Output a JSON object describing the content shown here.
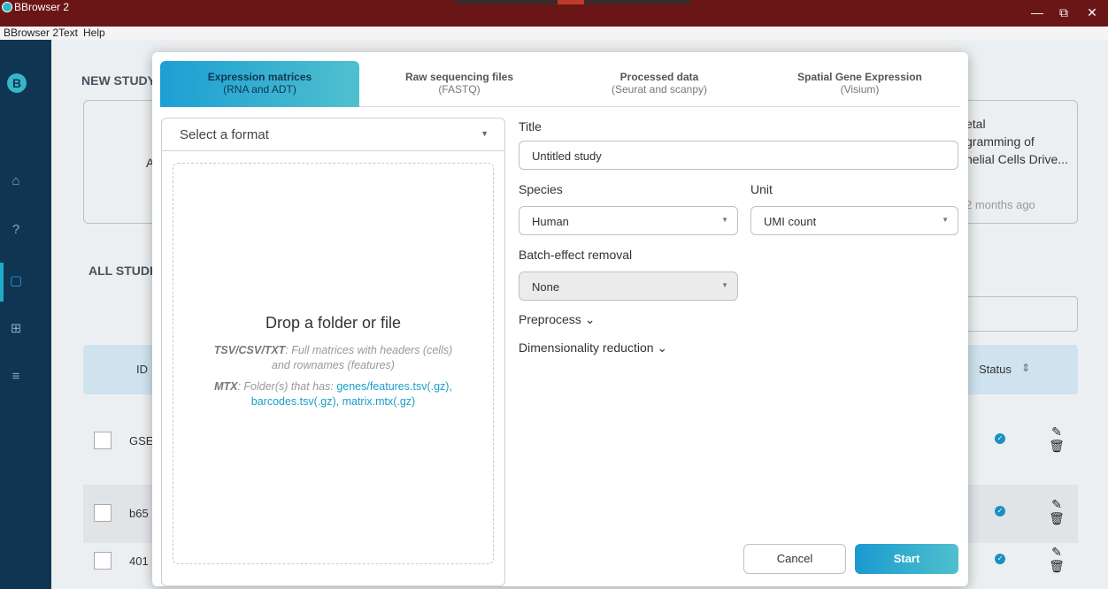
{
  "window": {
    "title": "BBrowser 2",
    "controls": {
      "minimize": "—",
      "restore": "⧉",
      "close": "✕"
    }
  },
  "menu": {
    "items": [
      "BBrowser 2",
      "Text",
      "Help"
    ]
  },
  "background": {
    "new_study": "NEW STUDY",
    "card_letter": "A",
    "recent_card": {
      "lines": [
        "etal",
        "gramming of",
        "helial Cells Drive..."
      ],
      "time": "2 months ago"
    },
    "all_studies": "ALL STUDIES",
    "table": {
      "col_id": "ID",
      "col_status": "Status",
      "sort_icon": "⇕",
      "rows": [
        {
          "id": "GSE"
        },
        {
          "id": "b65"
        },
        {
          "id": "401"
        }
      ]
    }
  },
  "modal": {
    "tabs": [
      {
        "title": "Expression matrices",
        "sub": "(RNA and ADT)"
      },
      {
        "title": "Raw sequencing files",
        "sub": "(FASTQ)"
      },
      {
        "title": "Processed data",
        "sub": "(Seurat and scanpy)"
      },
      {
        "title": "Spatial Gene Expression",
        "sub": "(Visium)"
      }
    ],
    "format_select": {
      "placeholder": "Select a format"
    },
    "dropzone": {
      "title": "Drop a folder or file",
      "tsv_label": "TSV/CSV/TXT",
      "tsv_text": ": Full matrices with headers (cells)",
      "tsv_text2": "and rownames (features)",
      "mtx_label": "MTX",
      "mtx_text": ": Folder(s) that has: ",
      "mtx_link1": "genes/features.tsv(.gz),",
      "mtx_link2": "barcodes.tsv(.gz), matrix.mtx(.gz)"
    },
    "form": {
      "title_label": "Title",
      "title_value": "Untitled study",
      "species_label": "Species",
      "species_value": "Human",
      "unit_label": "Unit",
      "unit_value": "UMI count",
      "batch_label": "Batch-effect removal",
      "batch_value": "None",
      "preprocess": "Preprocess ⌄",
      "dimred": "Dimensionality reduction ⌄"
    },
    "buttons": {
      "cancel": "Cancel",
      "start": "Start"
    }
  }
}
